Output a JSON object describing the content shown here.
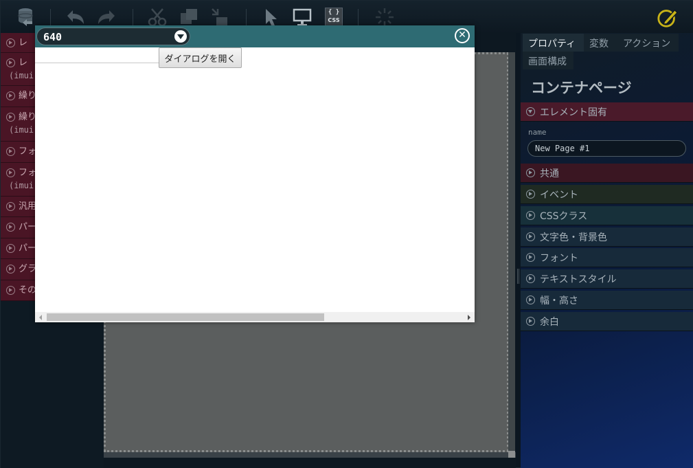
{
  "toolbar": {
    "icons": [
      "database-icon",
      "undo-icon",
      "redo-icon",
      "cut-icon",
      "copy-icon",
      "paste-icon",
      "pointer-icon",
      "display-icon",
      "css-icon",
      "loading-icon",
      "edit-icon"
    ],
    "css_label": "CSS",
    "css_brace": "{ }"
  },
  "palette": {
    "items": [
      {
        "label": "レ",
        "sub": ""
      },
      {
        "label": "レ",
        "sub": "(imui"
      },
      {
        "label": "繰り",
        "sub": ""
      },
      {
        "label": "繰り",
        "sub": "(imui"
      },
      {
        "label": "フォ",
        "sub": ""
      },
      {
        "label": "フォ",
        "sub": "(imui"
      },
      {
        "label": "汎用",
        "sub": ""
      },
      {
        "label": "パー",
        "sub": ""
      },
      {
        "label": "パー",
        "sub": ""
      },
      {
        "label": "グラ",
        "sub": ""
      },
      {
        "label": "その",
        "sub": ""
      }
    ]
  },
  "dialog": {
    "size_value": "640",
    "close_symbol": "✕",
    "text_value": "",
    "button_label": "ダイアログを開く"
  },
  "right_panel": {
    "tabs": {
      "properties": "プロパティ",
      "variables": "変数",
      "actions": "アクション",
      "screen": "画面構成"
    },
    "title": "コンテナページ",
    "sections": {
      "element": "エレメント固有",
      "common": "共通",
      "event": "イベント",
      "css": "CSSクラス",
      "color": "文字色・背景色",
      "font": "フォント",
      "text_style": "テキストスタイル",
      "size": "幅・高さ",
      "margin": "余白"
    },
    "name_label": "name",
    "name_value": "New Page #1"
  },
  "colors": {
    "accent_dialog_header": "#2e6b73",
    "palette_item": "#4a1525",
    "section_common": "#3a1622",
    "section_event": "#1f2a22",
    "section_css": "#17303a",
    "section_default": "#172a3a",
    "edit_icon": "#c8b318"
  }
}
